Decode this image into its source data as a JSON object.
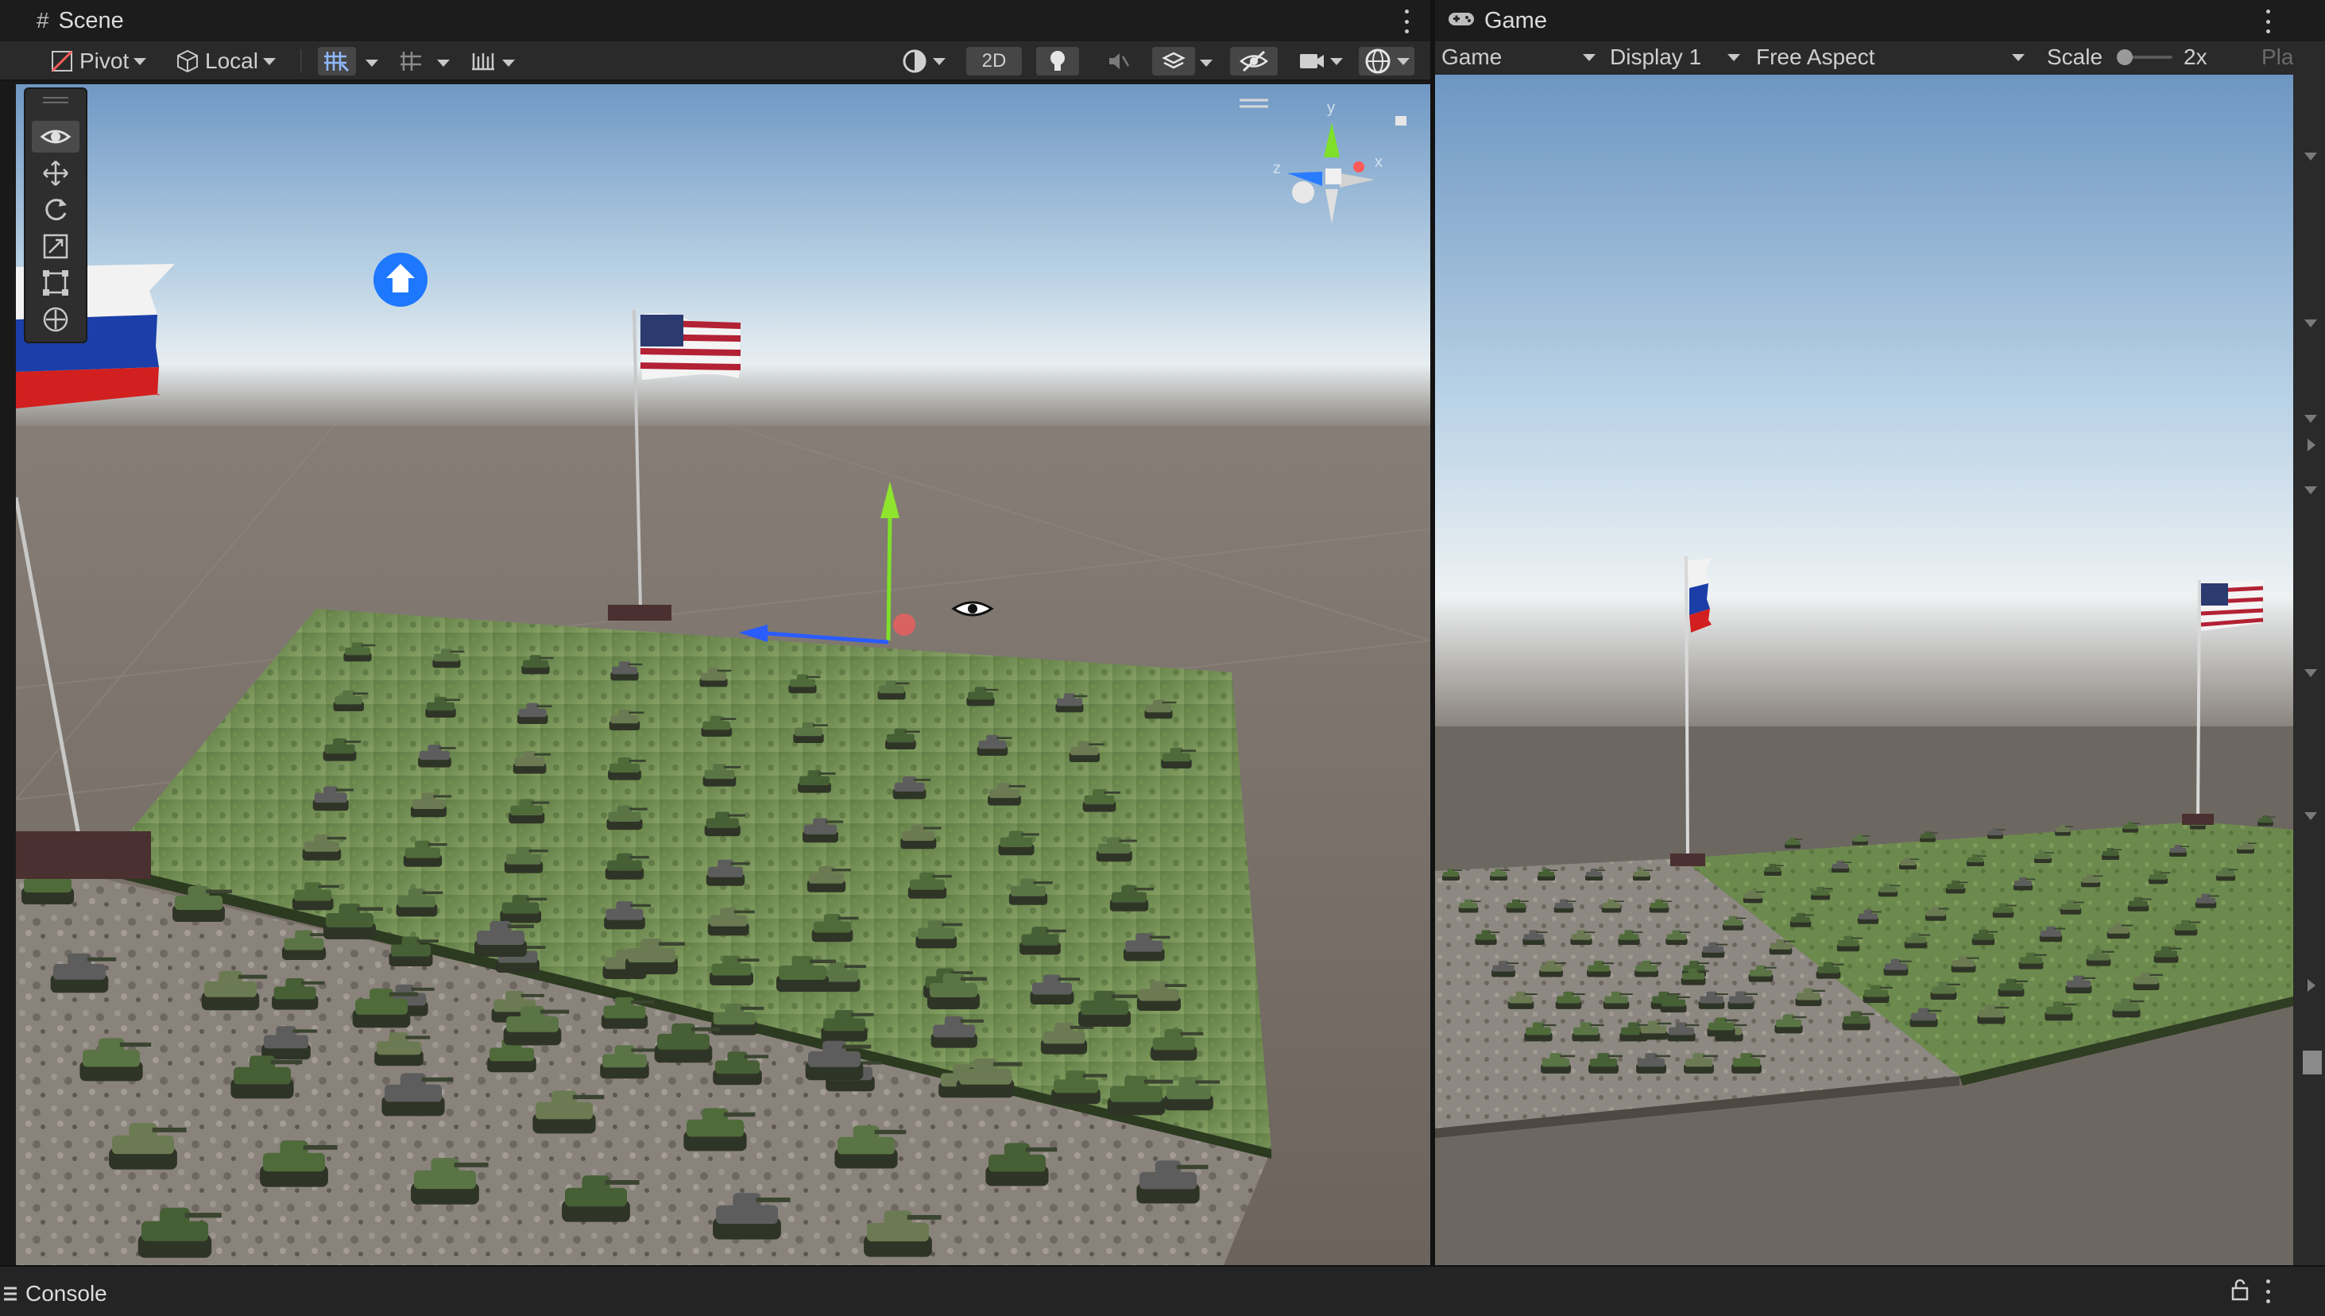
{
  "scene_tab": {
    "title": "Scene"
  },
  "game_tab": {
    "title": "Game"
  },
  "scene_toolbar": {
    "pivot_label": "Pivot",
    "local_label": "Local",
    "mode_2d_label": "2D"
  },
  "game_toolbar": {
    "view_label": "Game",
    "display_label": "Display 1",
    "aspect_label": "Free Aspect",
    "scale_label": "Scale",
    "scale_value": "2x",
    "play_label_partial": "Pla"
  },
  "gizmo": {
    "y_label": "y",
    "x_label": "x",
    "z_label": "z"
  },
  "console": {
    "title": "Console"
  },
  "colors": {
    "accent": "#2f8cff",
    "panel": "#2a2a2a",
    "sky_top": "#7ea4c9",
    "grass": "#6a8a45",
    "gravel": "#8a8580"
  }
}
